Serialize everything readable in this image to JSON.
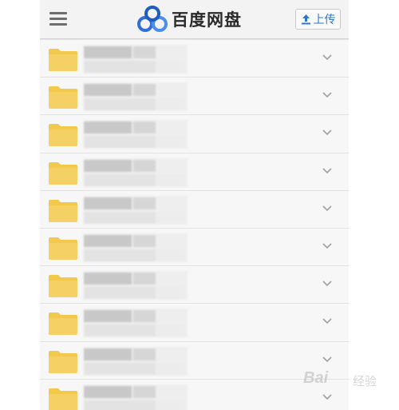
{
  "header": {
    "title": "百度网盘",
    "upload_label": "上传"
  },
  "icons": {
    "menu": "hamburger-menu-icon",
    "logo": "baidu-netdisk-logo-icon",
    "upload": "upload-arrow-icon",
    "folder": "folder-icon",
    "chevron": "chevron-down-icon"
  },
  "colors": {
    "folder": "#f2c94c",
    "accent": "#2d79c7",
    "logo_blue": "#2f6fd6"
  },
  "folders": [
    {
      "name": ""
    },
    {
      "name": ""
    },
    {
      "name": ""
    },
    {
      "name": ""
    },
    {
      "name": ""
    },
    {
      "name": ""
    },
    {
      "name": ""
    },
    {
      "name": ""
    },
    {
      "name": ""
    },
    {
      "name": ""
    }
  ],
  "watermark": {
    "brand": "Bai",
    "sub": "经验"
  }
}
